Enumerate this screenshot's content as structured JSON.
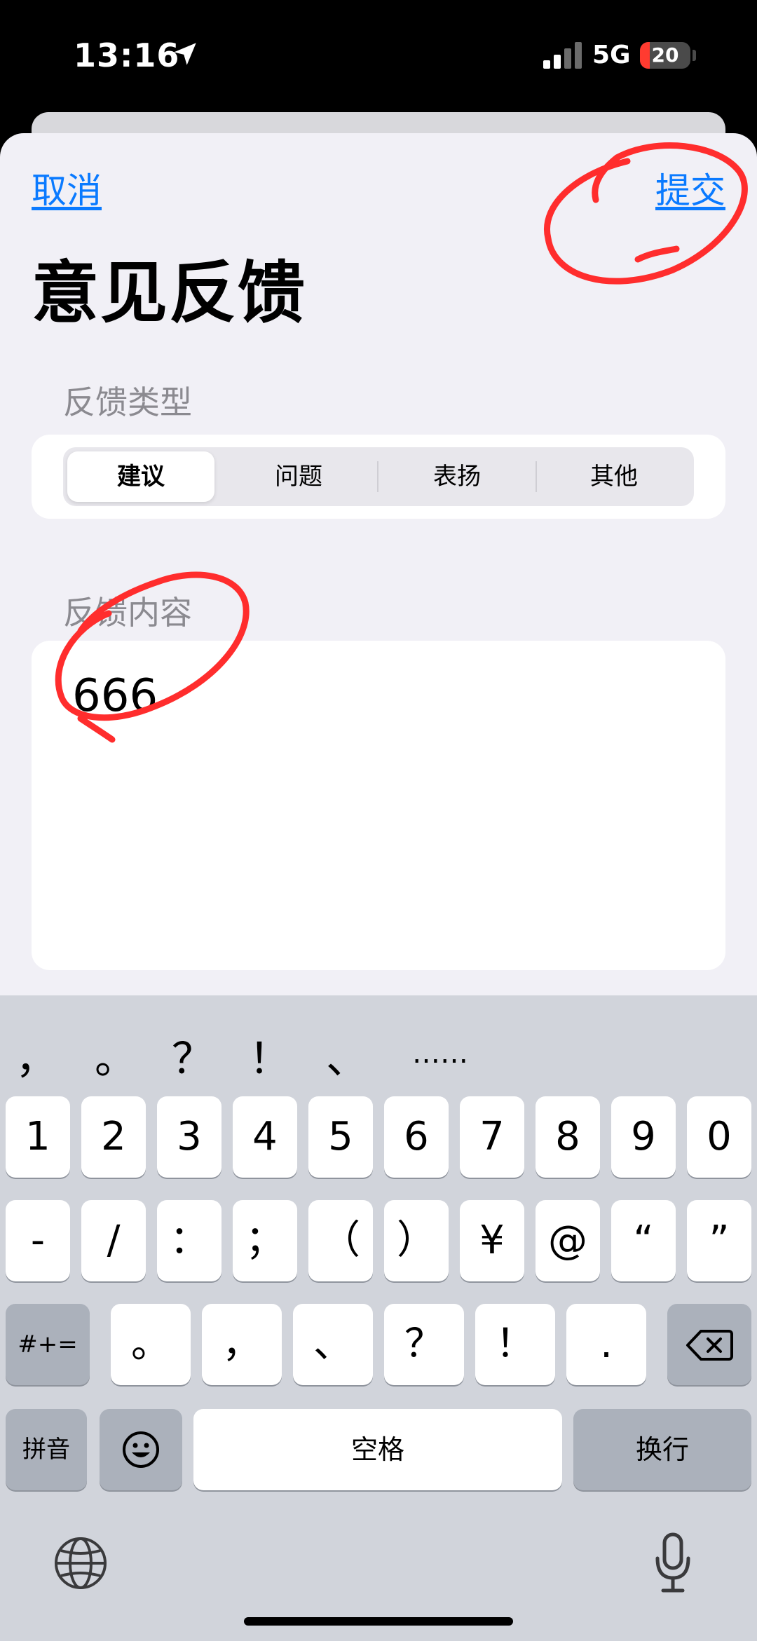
{
  "status_bar": {
    "time": "13:16",
    "network": "5G",
    "battery": "20",
    "battery_level": 0.2
  },
  "nav": {
    "cancel": "取消",
    "submit": "提交"
  },
  "title": "意见反馈",
  "type_section": {
    "label": "反馈类型",
    "segments": [
      "建议",
      "问题",
      "表扬",
      "其他"
    ],
    "selected": "建议"
  },
  "content_section": {
    "label": "反馈内容",
    "value": "666"
  },
  "keyboard": {
    "candidates": [
      "，",
      "。",
      "？",
      "！",
      "、",
      "……"
    ],
    "number_row": [
      "1",
      "2",
      "3",
      "4",
      "5",
      "6",
      "7",
      "8",
      "9",
      "0"
    ],
    "symbol_row": [
      "-",
      "/",
      "：",
      "；",
      "（",
      "）",
      "¥",
      "@",
      "“",
      "”"
    ],
    "more_symbols": "#+=",
    "punct_row": [
      "。",
      "，",
      "、",
      "？",
      "！",
      "."
    ],
    "pinyin": "拼音",
    "space": "空格",
    "return": "换行"
  },
  "colors": {
    "link": "#0a7aff",
    "annotation": "#ff2d2d",
    "sheet_bg": "#f1f0f6",
    "keyboard_bg": "#d1d4db"
  }
}
